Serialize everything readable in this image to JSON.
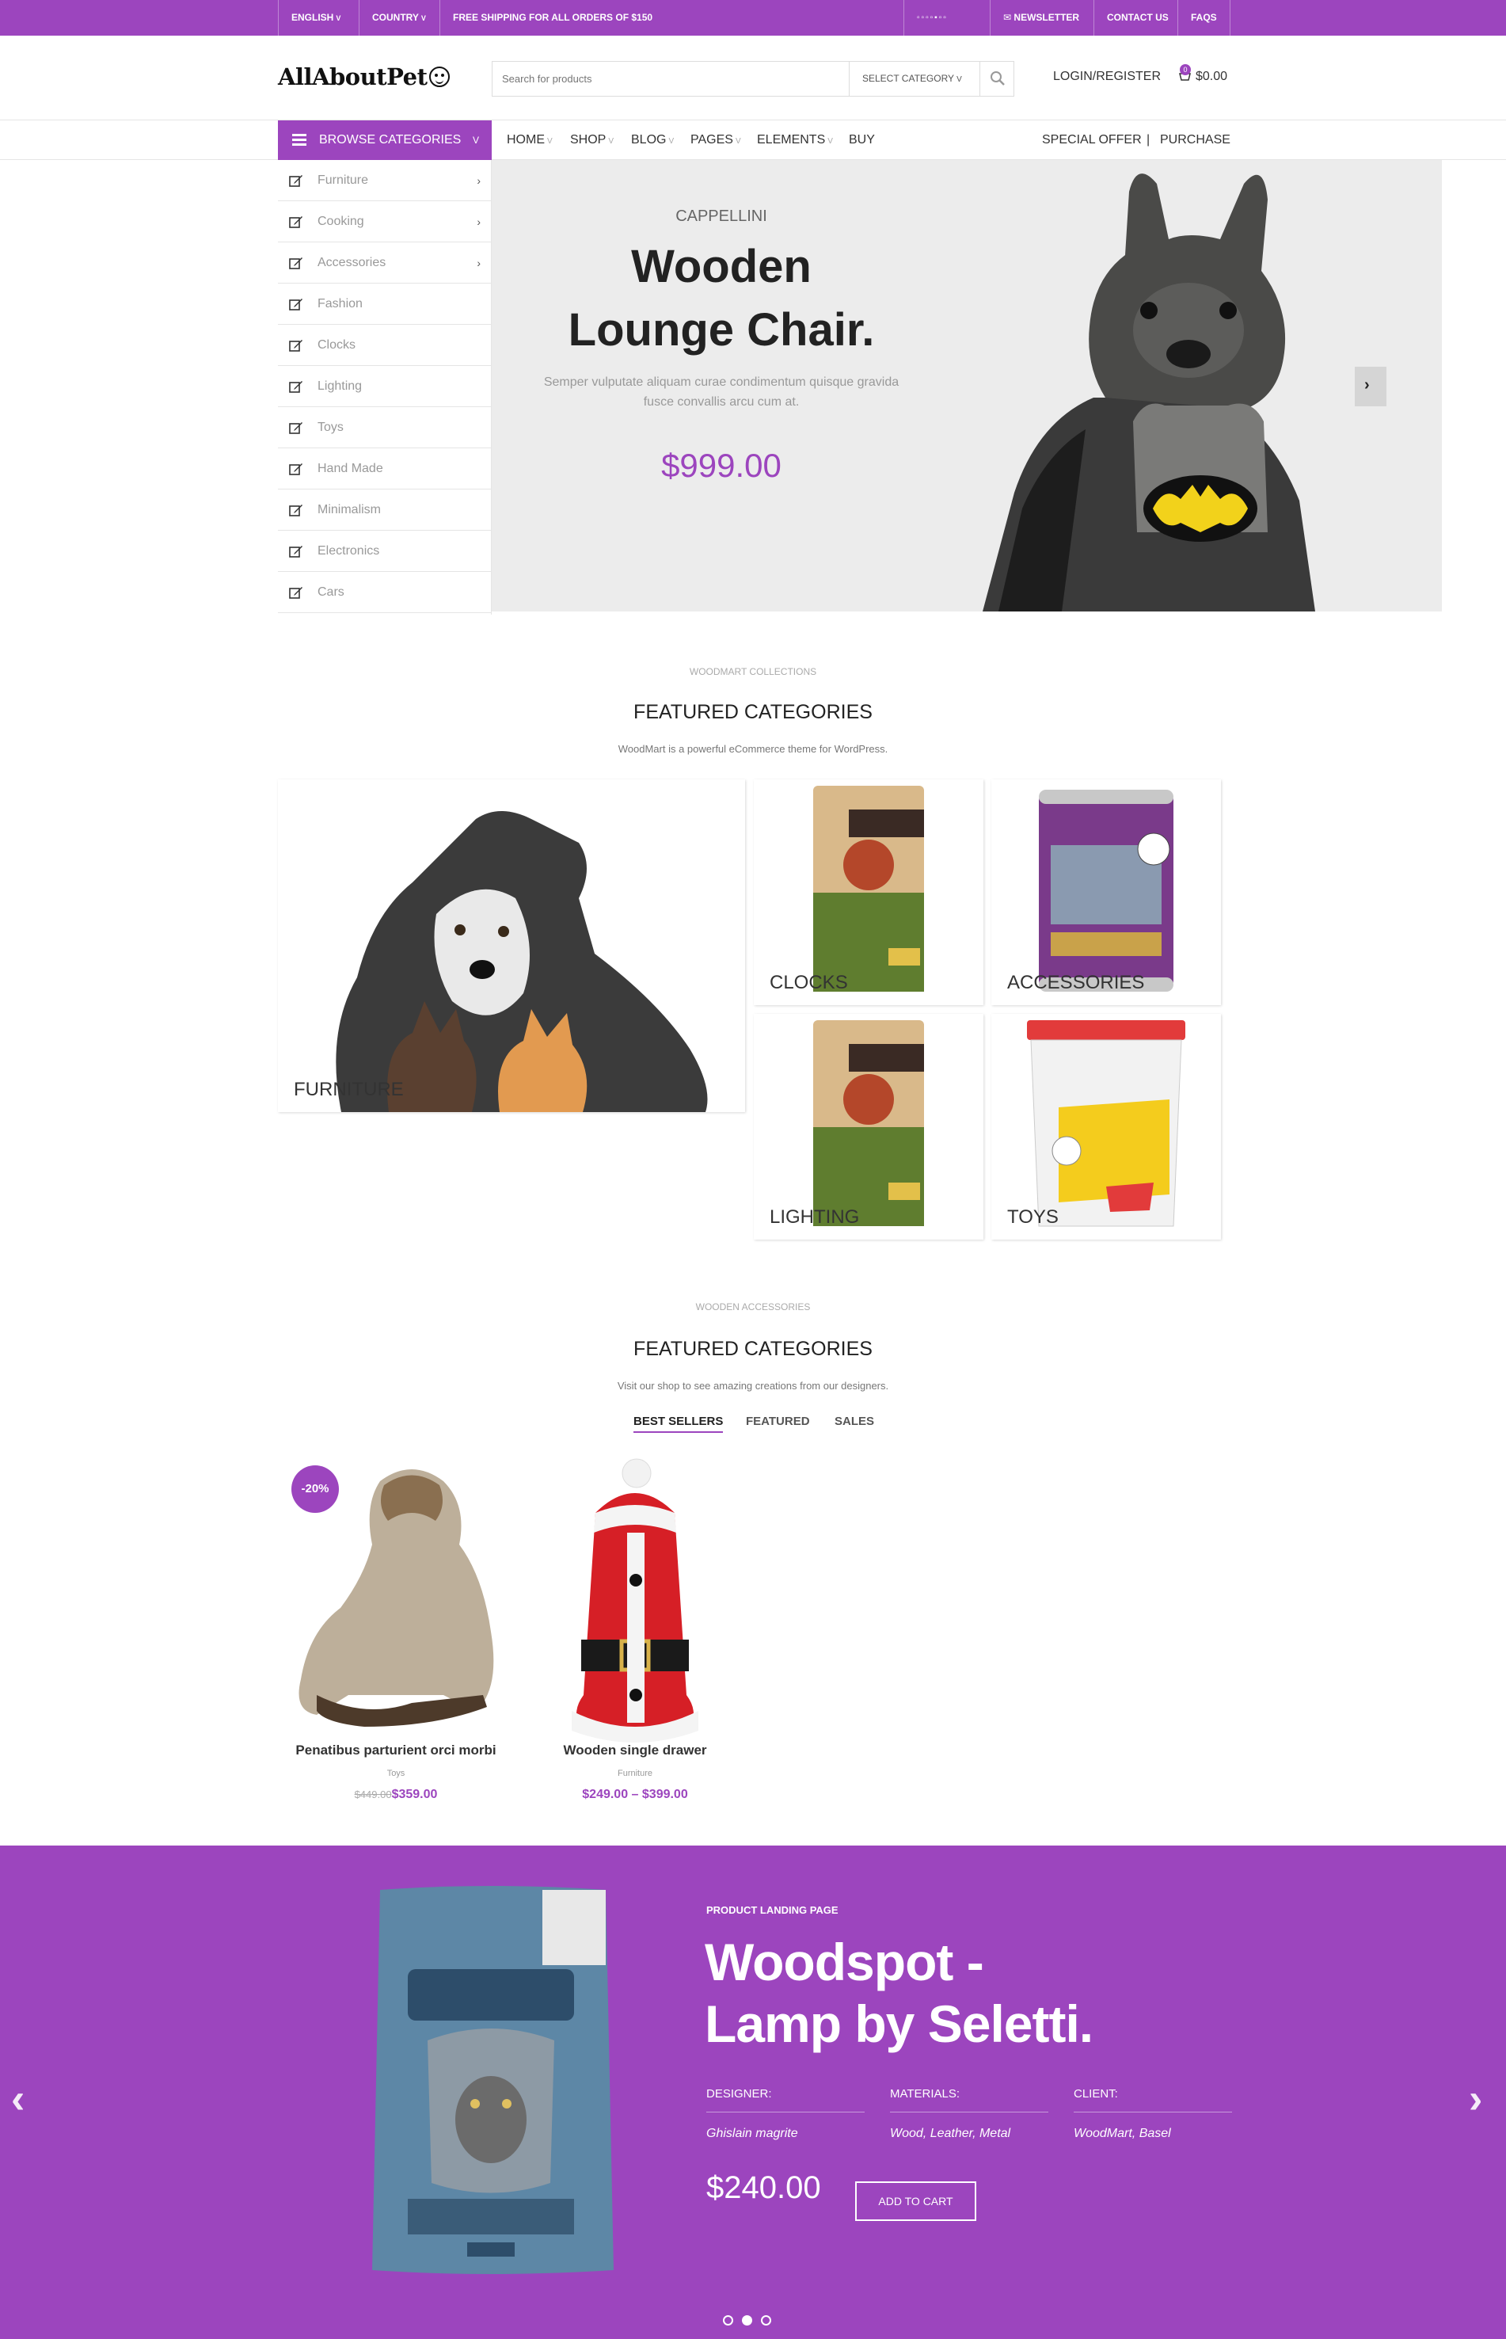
{
  "topbar": {
    "language": "ENGLISH",
    "country": "COUNTRY",
    "shipping": "FREE SHIPPING FOR ALL ORDERS OF $150",
    "newsletter": "NEWSLETTER",
    "contact": "CONTACT US",
    "faqs": "FAQS"
  },
  "header": {
    "logo": "AllAboutPet",
    "search_placeholder": "Search for products",
    "category_select": "SELECT CATEGORY",
    "login": "LOGIN/REGISTER",
    "cart_count": "0",
    "cart_total": "$0.00"
  },
  "nav": {
    "browse_label": "BROWSE CATEGORIES",
    "items": [
      "HOME",
      "SHOP",
      "BLOG",
      "PAGES",
      "ELEMENTS",
      "BUY"
    ],
    "special_offer": "SPECIAL OFFER",
    "separator": "|",
    "purchase": "PURCHASE"
  },
  "categories": [
    "Furniture",
    "Cooking",
    "Accessories",
    "Fashion",
    "Clocks",
    "Lighting",
    "Toys",
    "Hand Made",
    "Minimalism",
    "Electronics",
    "Cars"
  ],
  "hero": {
    "brand": "CAPPELLINI",
    "title_line1": "Wooden",
    "title_line2": "Lounge Chair.",
    "description": "Semper vulputate aliquam curae condimentum quisque gravida fusce convallis arcu cum at.",
    "price": "$999.00"
  },
  "featured1": {
    "subtitle": "WOODMART COLLECTIONS",
    "title": "FEATURED CATEGORIES",
    "description": "WoodMart is a powerful eCommerce theme for WordPress.",
    "tiles": [
      "FURNITURE",
      "CLOCKS",
      "ACCESSORIES",
      "LIGHTING",
      "TOYS"
    ]
  },
  "featured2": {
    "subtitle": "WOODEN ACCESSORIES",
    "title": "FEATURED CATEGORIES",
    "description": "Visit our shop to see amazing creations from our designers.",
    "tabs": [
      "BEST SELLERS",
      "FEATURED",
      "SALES"
    ]
  },
  "products": [
    {
      "name": "Penatibus parturient orci morbi",
      "category": "Toys",
      "old_price": "$449.00",
      "price": "$359.00",
      "badge": "-20%"
    },
    {
      "name": "Wooden single drawer",
      "category": "Furniture",
      "price": "$249.00 – $399.00"
    }
  ],
  "landing": {
    "eyebrow": "PRODUCT LANDING PAGE",
    "title_line1": "Woodspot -",
    "title_line2": "Lamp by Seletti.",
    "designer_label": "DESIGNER:",
    "designer_value": "Ghislain magrite",
    "materials_label": "MATERIALS:",
    "materials_value": "Wood, Leather, Metal",
    "client_label": "CLIENT:",
    "client_value": "WoodMart, Basel",
    "price": "$240.00",
    "cta": "ADD TO CART",
    "active_slide": 2,
    "slide_count": 3
  },
  "colors": {
    "brand": "#9c45be",
    "hero_bg": "#ececec"
  }
}
